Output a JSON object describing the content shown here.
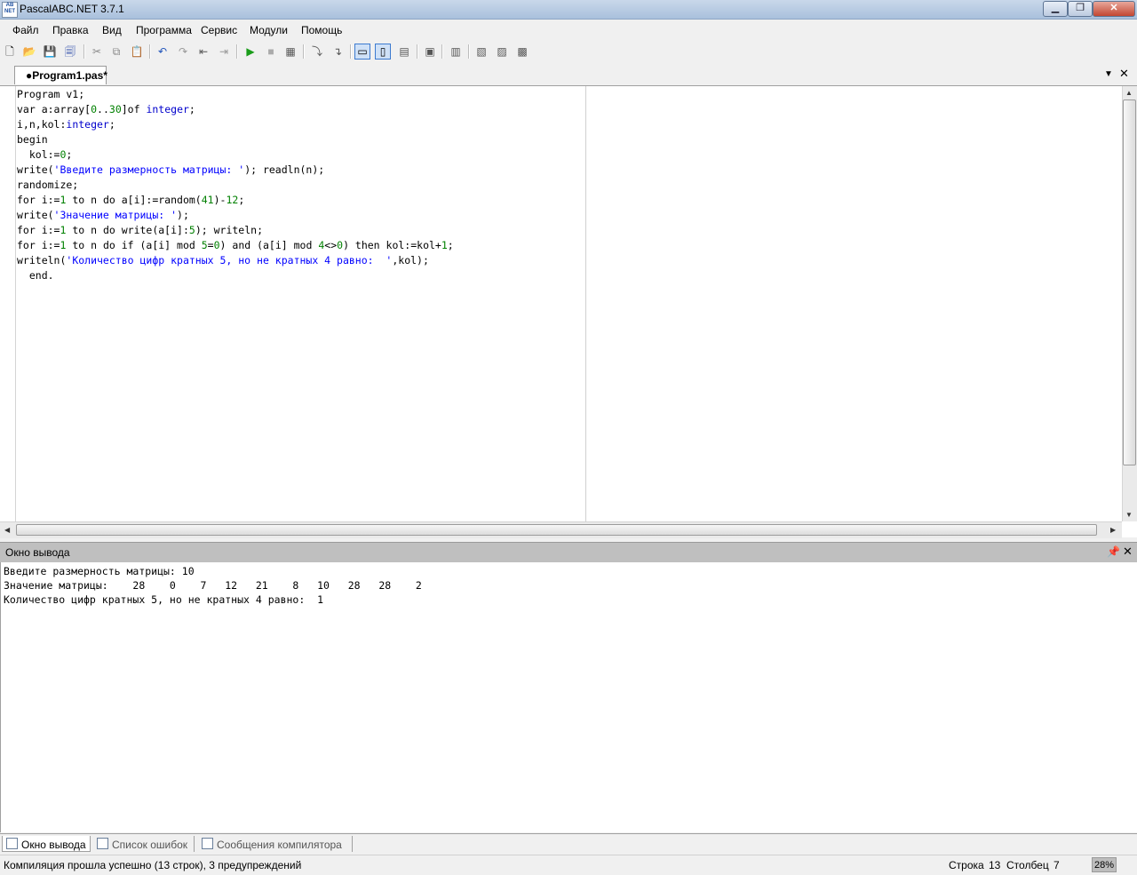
{
  "window": {
    "title": "PascalABC.NET 3.7.1",
    "icon_text": "AB\nNET"
  },
  "menu": [
    "Файл",
    "Правка",
    "Вид",
    "Программа",
    "Сервис",
    "Модули",
    "Помощь"
  ],
  "tab": {
    "label": "●Program1.pas*"
  },
  "code_lines": [
    "Program v1;",
    "var a:array[0..30]of integer;",
    "i,n,kol:integer;",
    "begin",
    "  kol:=0;",
    "write('Введите размерность матрицы: '); readln(n);",
    "randomize;",
    "for i:=1 to n do a[i]:=random(41)-12;",
    "write('Значение матрицы: ');",
    "for i:=1 to n do write(a[i]:5); writeln;",
    "for i:=1 to n do if (a[i] mod 5=0) and (a[i] mod 4<>0) then kol:=kol+1;",
    "writeln('Количество цифр кратных 5, но не кратных 4 равно:  ',kol);",
    "  end."
  ],
  "output": {
    "title": "Окно вывода",
    "lines": [
      "Введите размерность матрицы: 10",
      "Значение матрицы:    28    0    7   12   21    8   10   28   28    2",
      "Количество цифр кратных 5, но не кратных 4 равно:  1"
    ]
  },
  "bottom_tabs": [
    "Окно вывода",
    "Список ошибок",
    "Сообщения компилятора"
  ],
  "status": {
    "message": "Компиляция прошла успешно (13 строк), 3 предупреждений",
    "row_label": "Строка",
    "row": "13",
    "col_label": "Столбец",
    "col": "7",
    "zoom": "28%"
  },
  "colors": {
    "keyword_type": "#0000cc",
    "number": "#008000",
    "string": "#0000ff",
    "run": "#1a9c1a"
  }
}
